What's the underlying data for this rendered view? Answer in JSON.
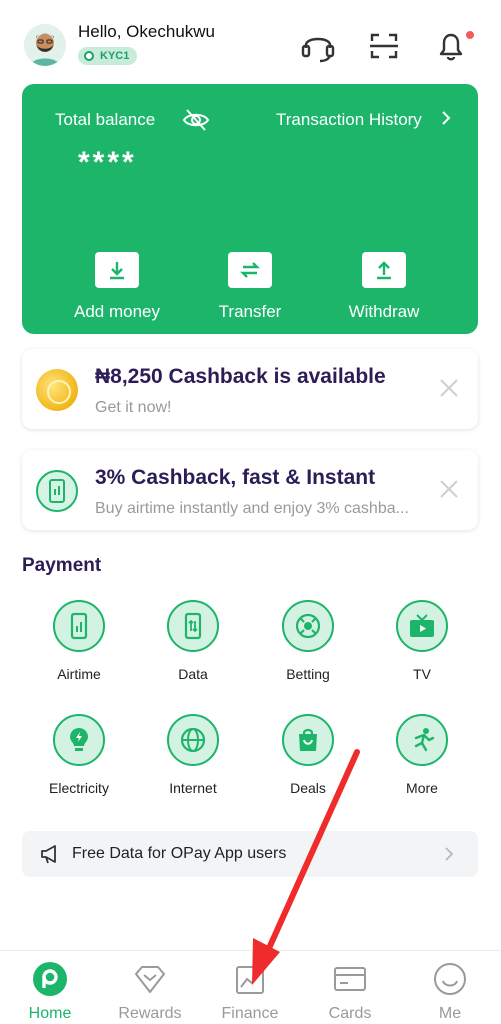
{
  "header": {
    "greeting": "Hello, Okechukwu",
    "kyc_badge": "KYC1",
    "icons": [
      "headset-icon",
      "scan-icon",
      "bell-icon"
    ]
  },
  "balance": {
    "label": "Total balance",
    "value": "****",
    "history_link": "Transaction History",
    "actions": [
      {
        "label": "Add money",
        "icon": "download-icon"
      },
      {
        "label": "Transfer",
        "icon": "transfer-icon"
      },
      {
        "label": "Withdraw",
        "icon": "upload-icon"
      }
    ]
  },
  "promos": [
    {
      "title": "₦8,250 Cashback is available",
      "subtitle": "Get it now!",
      "icon": "coin-icon"
    },
    {
      "title": "3% Cashback, fast & Instant",
      "subtitle": "Buy airtime instantly and enjoy 3% cashba...",
      "icon": "phone-icon"
    }
  ],
  "payment": {
    "title": "Payment",
    "services": [
      {
        "label": "Airtime",
        "icon": "airtime-icon"
      },
      {
        "label": "Data",
        "icon": "data-icon"
      },
      {
        "label": "Betting",
        "icon": "betting-icon"
      },
      {
        "label": "TV",
        "icon": "tv-icon"
      },
      {
        "label": "Electricity",
        "icon": "electricity-icon"
      },
      {
        "label": "Internet",
        "icon": "internet-icon"
      },
      {
        "label": "Deals",
        "icon": "deals-icon"
      },
      {
        "label": "More",
        "icon": "more-icon"
      }
    ]
  },
  "banner": {
    "text": "Free Data for OPay App users"
  },
  "nav": {
    "items": [
      {
        "label": "Home",
        "icon": "home-icon",
        "active": true
      },
      {
        "label": "Rewards",
        "icon": "rewards-icon",
        "active": false
      },
      {
        "label": "Finance",
        "icon": "finance-icon",
        "active": false
      },
      {
        "label": "Cards",
        "icon": "cards-icon",
        "active": false
      },
      {
        "label": "Me",
        "icon": "me-icon",
        "active": false
      }
    ]
  },
  "colors": {
    "brand_green": "#1cb56a",
    "title_purple": "#2c1d56",
    "notification_red": "#f45a5a",
    "annotation_arrow": "#ef2b2b"
  }
}
